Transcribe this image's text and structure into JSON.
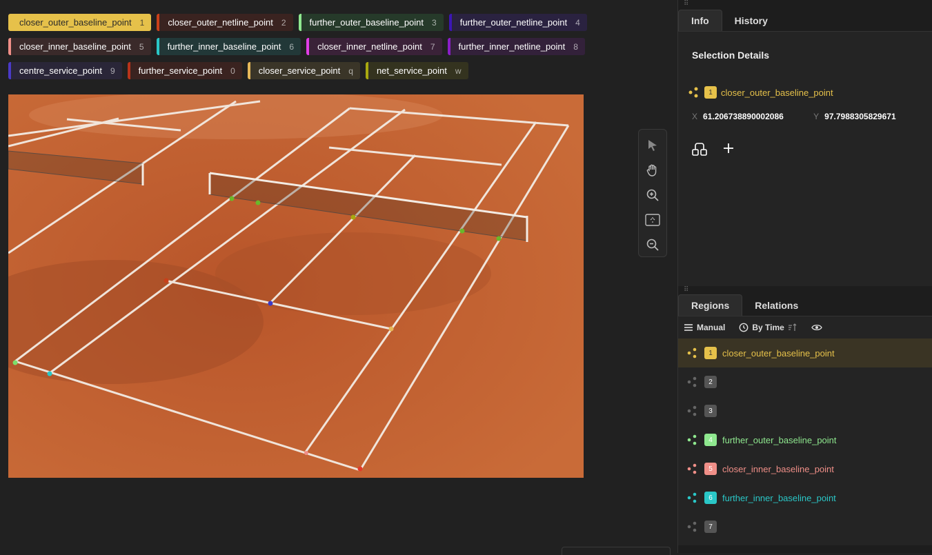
{
  "labels": [
    [
      {
        "name": "closer_outer_baseline_point",
        "key": "1",
        "color": "#e6c14a",
        "bg": "#e6c14a",
        "selected": true
      },
      {
        "name": "closer_outer_netline_point",
        "key": "2",
        "color": "#c8401a",
        "bg": "#3a2320"
      },
      {
        "name": "further_outer_baseline_point",
        "key": "3",
        "color": "#8fe88f",
        "bg": "#263a2a"
      },
      {
        "name": "further_outer_netline_point",
        "key": "4",
        "color": "#3c16b5",
        "bg": "#2a2240"
      }
    ],
    [
      {
        "name": "closer_inner_baseline_point",
        "key": "5",
        "color": "#f08f88",
        "bg": "#3a2a2a"
      },
      {
        "name": "further_inner_baseline_point",
        "key": "6",
        "color": "#2ac7c7",
        "bg": "#223838"
      },
      {
        "name": "closer_inner_netline_point",
        "key": "7",
        "color": "#e23ee6",
        "bg": "#3a2238"
      },
      {
        "name": "further_inner_netline_point",
        "key": "8",
        "color": "#8a1ec7",
        "bg": "#33213a"
      }
    ],
    [
      {
        "name": "centre_service_point",
        "key": "9",
        "color": "#4a3ac7",
        "bg": "#2a2638"
      },
      {
        "name": "further_service_point",
        "key": "0",
        "color": "#b8331a",
        "bg": "#3a2320"
      },
      {
        "name": "closer_service_point",
        "key": "q",
        "color": "#e6b85a",
        "bg": "#3a3528"
      },
      {
        "name": "net_service_point",
        "key": "w",
        "color": "#a8a810",
        "bg": "#34331f"
      }
    ]
  ],
  "info": {
    "tabs": [
      "Info",
      "History"
    ],
    "title": "Selection Details",
    "selected_label": "closer_outer_baseline_point",
    "selected_num": "1",
    "x_key": "X",
    "x_value": "61.206738890002086",
    "y_key": "Y",
    "y_value": "97.7988305829671"
  },
  "regions": {
    "tabs": [
      "Regions",
      "Relations"
    ],
    "manual": "Manual",
    "by_time": "By Time",
    "items": [
      {
        "num": "1",
        "label": "closer_outer_baseline_point",
        "color": "#e6c14a",
        "selected": true
      },
      {
        "num": "2",
        "label": "",
        "color": "#666"
      },
      {
        "num": "3",
        "label": "",
        "color": "#666"
      },
      {
        "num": "4",
        "label": "further_outer_baseline_point",
        "color": "#8fe88f"
      },
      {
        "num": "5",
        "label": "closer_inner_baseline_point",
        "color": "#f08f88"
      },
      {
        "num": "6",
        "label": "further_inner_baseline_point",
        "color": "#2ac7c7"
      },
      {
        "num": "7",
        "label": "",
        "color": "#666"
      }
    ]
  },
  "icons": {
    "toolbar": [
      "cursor-icon",
      "hand-icon",
      "zoom-in-icon",
      "fit-icon",
      "zoom-out-icon"
    ]
  }
}
